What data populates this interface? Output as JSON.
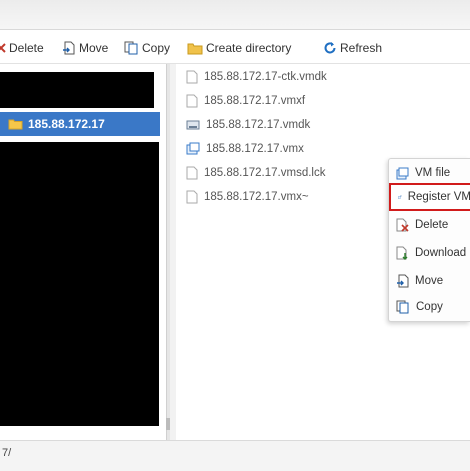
{
  "toolbar": {
    "delete_label": "Delete",
    "move_label": "Move",
    "copy_label": "Copy",
    "create_directory_label": "Create directory",
    "refresh_label": "Refresh"
  },
  "tree": {
    "selected_label": "185.88.172.17"
  },
  "files": [
    {
      "name": "185.88.172.17-ctk.vmdk",
      "icon": "file-icon"
    },
    {
      "name": "185.88.172.17.vmxf",
      "icon": "file-icon"
    },
    {
      "name": "185.88.172.17.vmdk",
      "icon": "disk-icon"
    },
    {
      "name": "185.88.172.17.vmx",
      "icon": "vm-icon"
    },
    {
      "name": "185.88.172.17.vmsd.lck",
      "icon": "file-icon"
    },
    {
      "name": "185.88.172.17.vmx~",
      "icon": "file-icon"
    }
  ],
  "context_menu": {
    "items": [
      {
        "label": "VM file",
        "icon": "vm-icon"
      },
      {
        "label": "Register VM",
        "icon": "register-icon"
      },
      {
        "label": "Delete",
        "icon": "delete-icon"
      },
      {
        "label": "Download",
        "icon": "download-icon"
      },
      {
        "label": "Move",
        "icon": "move-icon"
      },
      {
        "label": "Copy",
        "icon": "copy-icon"
      }
    ]
  },
  "status": {
    "path_text": "7/"
  },
  "colors": {
    "selection": "#3a78c7",
    "highlight_border": "#d11b1b"
  }
}
